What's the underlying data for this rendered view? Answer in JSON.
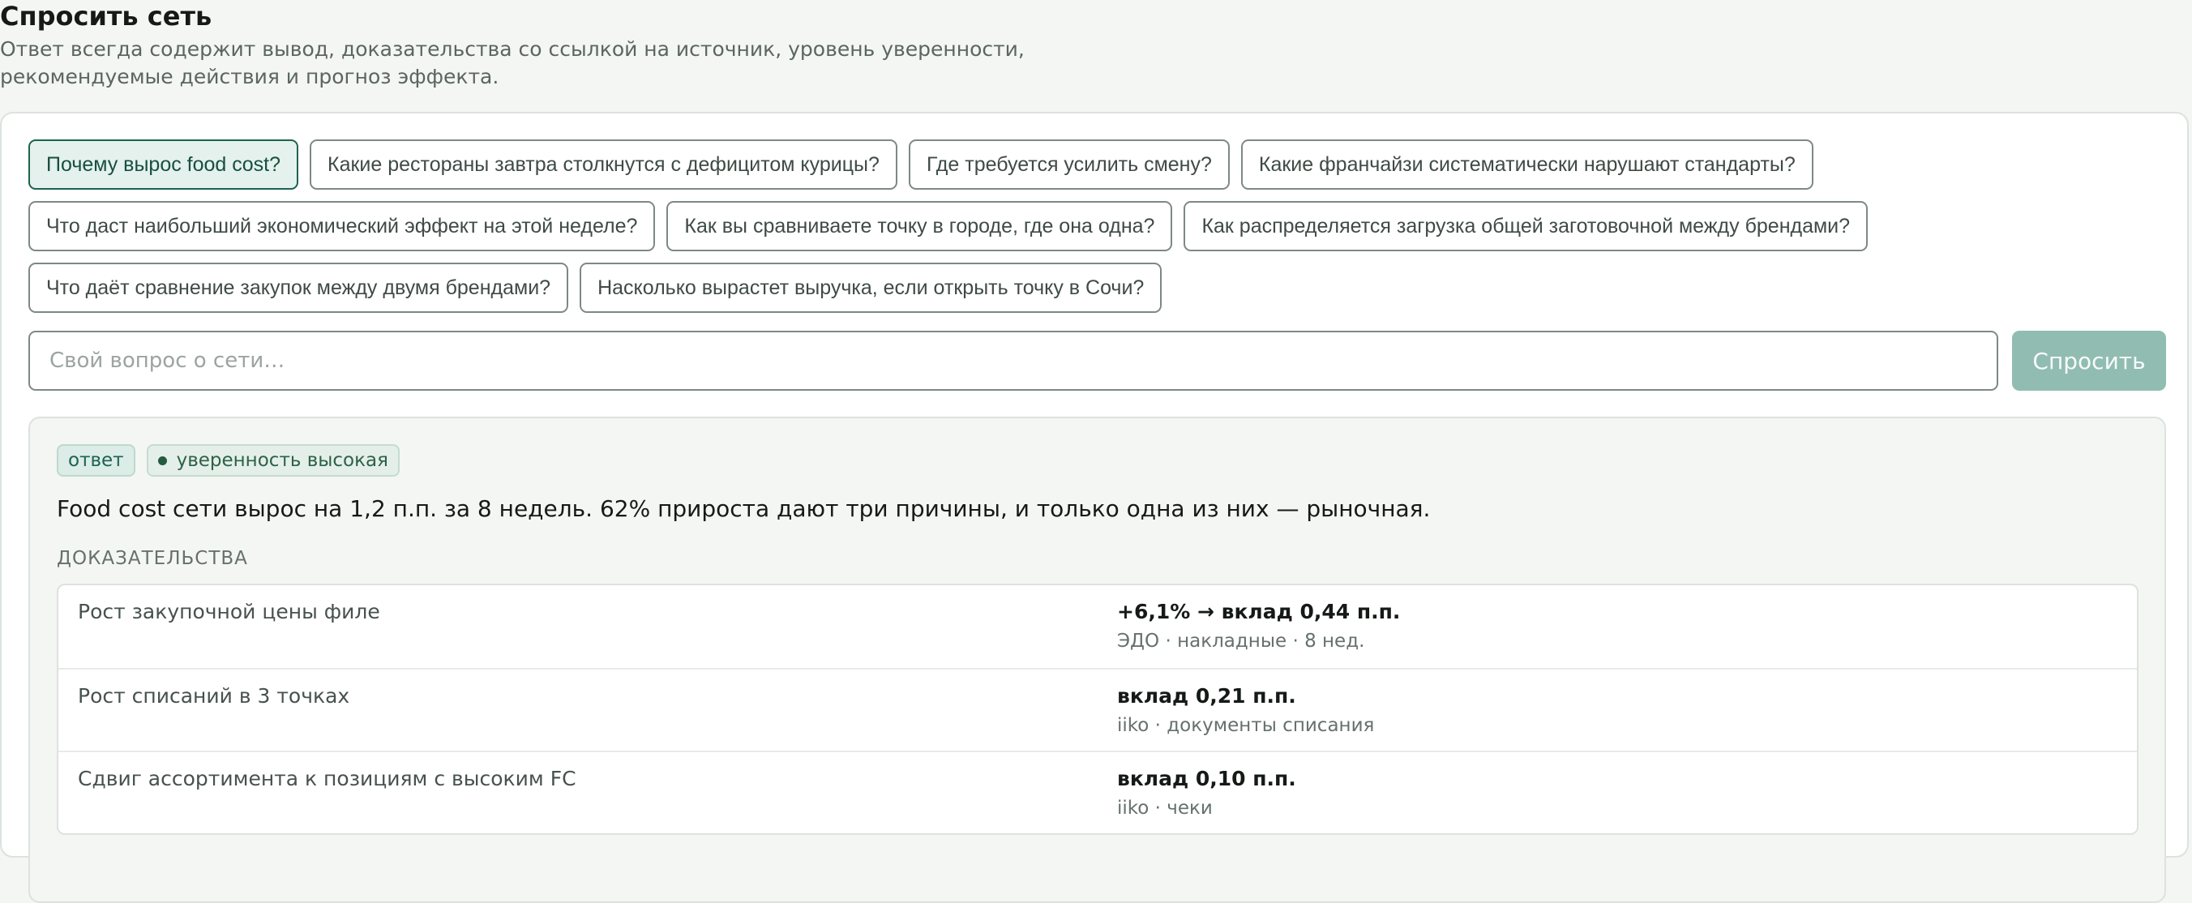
{
  "header": {
    "title": "Спросить сеть",
    "subtitle": "Ответ всегда содержит вывод, доказательства со ссылкой на источник, уровень уверенности, рекомендуемые действия и прогноз эффекта."
  },
  "suggestions": [
    "Почему вырос food cost?",
    "Какие рестораны завтра столкнутся с дефицитом курицы?",
    "Где требуется усилить смену?",
    "Какие франчайзи систематически нарушают стандарты?",
    "Что даст наибольший экономический эффект на этой неделе?",
    "Как вы сравниваете точку в городе, где она одна?",
    "Как распределяется загрузка общей заготовочной между брендами?",
    "Что даёт сравнение закупок между двумя брендами?",
    "Насколько вырастет выручка, если открыть точку в Сочи?"
  ],
  "ask": {
    "placeholder": "Свой вопрос о сети…",
    "button_label": "Спросить"
  },
  "answer": {
    "badge": "ответ",
    "confidence": "уверенность высокая",
    "text": "Food cost сети вырос на 1,2 п.п. за 8 недель. 62% прироста дают три причины, и только одна из них — рыночная.",
    "evidence_title": "ДОКАЗАТЕЛЬСТВА",
    "evidence": [
      {
        "factor": "Рост закупочной цены филе",
        "impact": "+6,1% → вклад 0,44 п.п.",
        "source": "ЭДО · накладные · 8 нед."
      },
      {
        "factor": "Рост списаний в 3 точках",
        "impact": "вклад 0,21 п.п.",
        "source": "iiko · документы списания"
      },
      {
        "factor": "Сдвиг ассортимента к позициям с высоким FC",
        "impact": "вклад 0,10 п.п.",
        "source": "iiko · чеки"
      }
    ]
  },
  "colors": {
    "accent": "#1d6351",
    "button_disabled": "#91bcb2",
    "background": "#f4f6f3"
  }
}
